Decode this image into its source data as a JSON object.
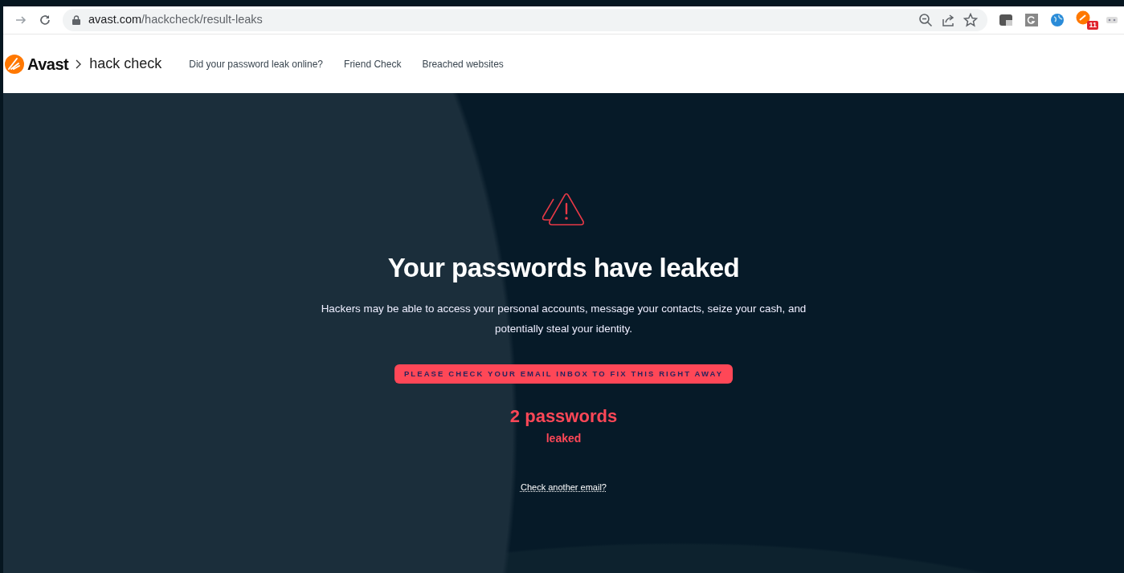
{
  "browser": {
    "url_host": "avast.com",
    "url_path": "/hackcheck/result-leaks",
    "extension_badge": "11"
  },
  "site_header": {
    "logo": "Avast",
    "section": "hack check",
    "nav": [
      {
        "label": "Did your password leak online?"
      },
      {
        "label": "Friend Check"
      },
      {
        "label": "Breached websites"
      }
    ]
  },
  "hero": {
    "title": "Your passwords have leaked",
    "text": "Hackers may be able to access your personal accounts, message your contacts, seize your cash, and potentially steal your identity.",
    "alert": "PLEASE CHECK YOUR EMAIL INBOX TO FIX THIS RIGHT AWAY",
    "count": "2 passwords",
    "count_label": "leaked",
    "link": "Check another email?"
  }
}
